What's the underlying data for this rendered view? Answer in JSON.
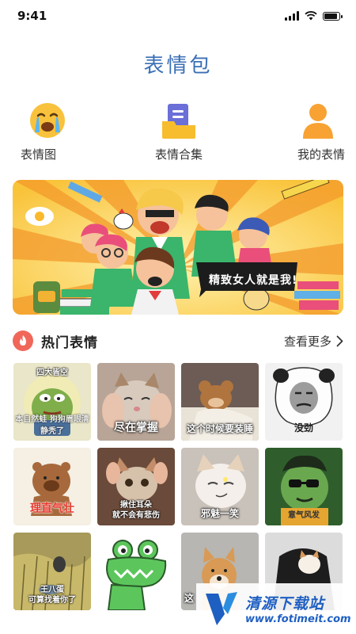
{
  "status_bar": {
    "time": "9:41",
    "battery_level": 0.9
  },
  "app": {
    "title": "表情包"
  },
  "categories": [
    {
      "label": "表情图",
      "icon": "crying-face-icon"
    },
    {
      "label": "表情合集",
      "icon": "folder-document-icon"
    },
    {
      "label": "我的表情",
      "icon": "user-icon"
    }
  ],
  "banner": {
    "caption": "精致女人就是我!"
  },
  "hot_section": {
    "title": "热门表情",
    "icon": "fire-icon",
    "see_more": "查看更多",
    "accent_color": "#f0675a"
  },
  "stickers": [
    {
      "caption": "四大皆空",
      "subcaption": "本自然蛙  狗狗眉眼清静秃了"
    },
    {
      "caption": "尽在掌握"
    },
    {
      "caption": "这个时候要装睡"
    },
    {
      "caption": "没劲"
    },
    {
      "caption": "理直气壮"
    },
    {
      "caption": "揪住耳朵",
      "subcaption": "就不会有悲伤"
    },
    {
      "caption": "邪魅一笑"
    },
    {
      "caption": "意气风发"
    },
    {
      "caption": "王八蛋",
      "subcaption": "可算找着你了"
    },
    {
      "caption": ""
    },
    {
      "caption": "这"
    },
    {
      "caption": ""
    }
  ],
  "watermark": {
    "name": "清源下载站",
    "url": "www.fotimeit.com"
  },
  "colors": {
    "title_blue": "#3b6fb6",
    "watermark_blue": "#1e5fc2"
  }
}
